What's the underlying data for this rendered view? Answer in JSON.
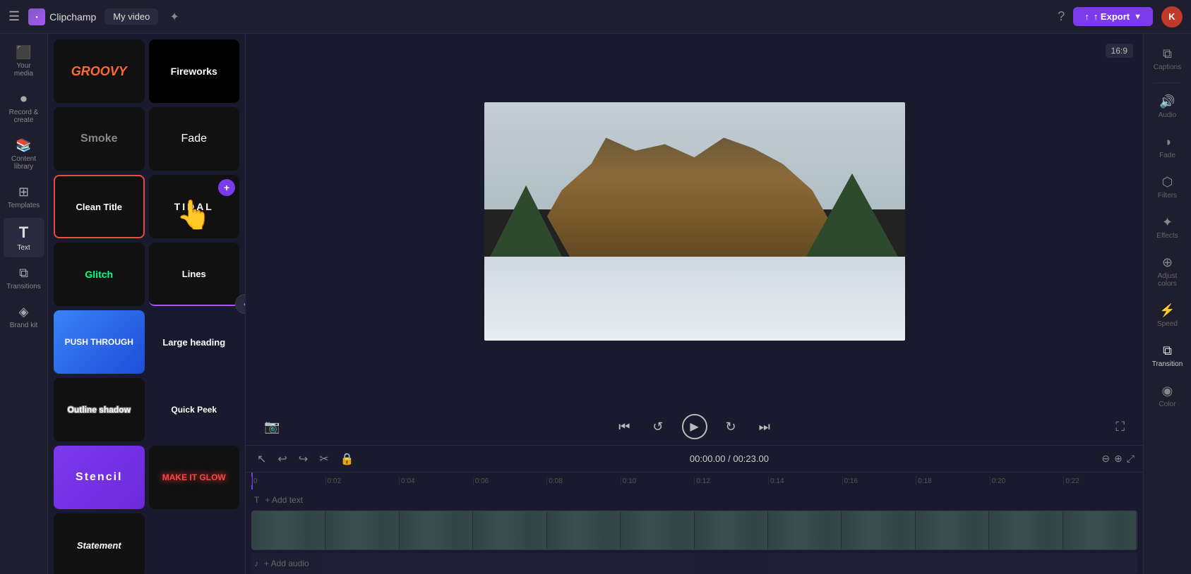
{
  "app": {
    "title": "Clipchamp",
    "video_title": "My video"
  },
  "topbar": {
    "menu_icon": "☰",
    "logo_text": "Clipchamp",
    "export_label": "↑ Export",
    "help_icon": "?",
    "avatar_text": "K",
    "ratio": "16:9"
  },
  "left_nav": {
    "items": [
      {
        "id": "your-media",
        "icon": "⬛",
        "label": "Your media"
      },
      {
        "id": "record",
        "icon": "⏺",
        "label": "Record & create"
      },
      {
        "id": "content-library",
        "icon": "📚",
        "label": "Content library"
      },
      {
        "id": "templates",
        "icon": "⊞",
        "label": "Templates"
      },
      {
        "id": "text",
        "icon": "T",
        "label": "Text",
        "active": true
      },
      {
        "id": "transitions",
        "icon": "⧉",
        "label": "Transitions"
      },
      {
        "id": "brand-kit",
        "icon": "◈",
        "label": "Brand kit"
      }
    ]
  },
  "text_panel": {
    "cards": [
      {
        "id": "groovy",
        "class": "card-groovy",
        "text": "GROOVY"
      },
      {
        "id": "fireworks",
        "class": "card-fireworks",
        "text": "Fireworks"
      },
      {
        "id": "smoke",
        "class": "card-smoke",
        "text": "Smoke"
      },
      {
        "id": "fade",
        "class": "card-fade",
        "text": "Fade"
      },
      {
        "id": "clean-title",
        "class": "card-clean",
        "text": "Clean Title"
      },
      {
        "id": "tidal",
        "class": "card-tidal",
        "text": "TIDAL"
      },
      {
        "id": "glitch",
        "class": "card-glitch",
        "text": "Glitch"
      },
      {
        "id": "lines",
        "class": "card-lines",
        "text": "Lines"
      },
      {
        "id": "push-through",
        "class": "card-push",
        "text": "PUSH THROUGH"
      },
      {
        "id": "large-heading",
        "class": "card-large",
        "text": "Large heading"
      },
      {
        "id": "outline-shadow",
        "class": "card-outline",
        "text": "Outline shadow"
      },
      {
        "id": "quick-peek",
        "class": "card-quick",
        "text": "Quick Peek"
      },
      {
        "id": "stencil",
        "class": "card-stencil",
        "text": "Stencil"
      },
      {
        "id": "make-it-glow",
        "class": "card-glow",
        "text": "MAKE IT GLOW"
      },
      {
        "id": "statement",
        "class": "card-statement",
        "text": "Statement"
      }
    ]
  },
  "timeline": {
    "current_time": "00:00.00",
    "total_time": "00:23.00",
    "time_display": "00:00.00 / 00:23.00",
    "ruler_marks": [
      "0",
      "0:02",
      "0:04",
      "0:06",
      "0:08",
      "0:10",
      "0:12",
      "0:14",
      "0:16",
      "0:18",
      "0:20",
      "0:22"
    ],
    "add_text_label": "+ Add text",
    "add_audio_label": "+ Add audio",
    "text_icon": "T",
    "audio_icon": "♪"
  },
  "right_sidebar": {
    "tools": [
      {
        "id": "captions",
        "icon": "⧉",
        "label": "Captions"
      },
      {
        "id": "audio",
        "icon": "🔊",
        "label": "Audio"
      },
      {
        "id": "fade",
        "icon": "◑",
        "label": "Fade"
      },
      {
        "id": "filters",
        "icon": "⬡",
        "label": "Filters"
      },
      {
        "id": "effects",
        "icon": "✦",
        "label": "Effects"
      },
      {
        "id": "adjust-colors",
        "icon": "⊕",
        "label": "Adjust colors"
      },
      {
        "id": "speed",
        "icon": "⚡",
        "label": "Speed"
      },
      {
        "id": "transition",
        "icon": "⧉",
        "label": "Transition",
        "active": true
      },
      {
        "id": "color",
        "icon": "◉",
        "label": "Color"
      }
    ]
  }
}
